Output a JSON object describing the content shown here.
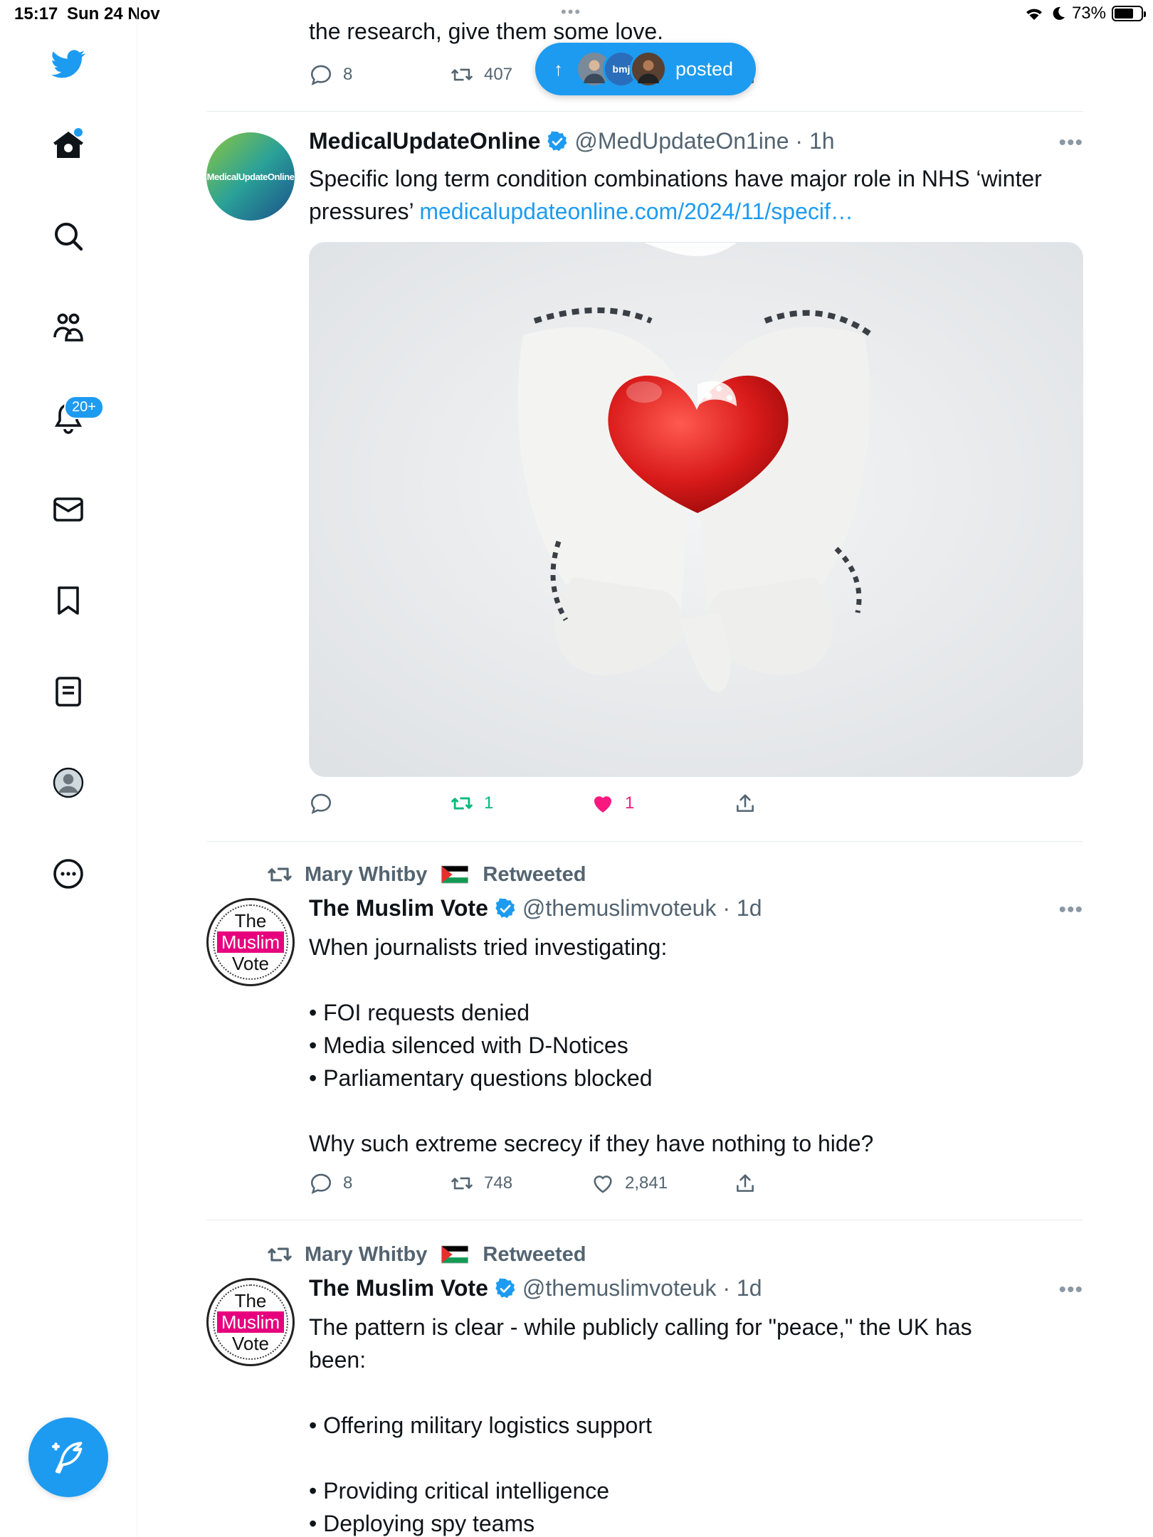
{
  "status_bar": {
    "time": "15:17",
    "date": "Sun 24 Nov",
    "battery": "73%",
    "battery_level": 0.73
  },
  "sidebar": {
    "notifications_badge": "20+"
  },
  "previous_tweet": {
    "text_tail": "the research, give them some love.",
    "replies": "8",
    "retweets": "407"
  },
  "new_posts_pill": {
    "label": "posted",
    "avatar_text": "bmj"
  },
  "tweets": [
    {
      "display_name": "MedicalUpdateOnline",
      "handle": "@MedUpdateOn1ine",
      "time": "1h",
      "avatar_text": "MedicalUpdateOnline",
      "text": "Specific long term condition combinations have major role in NHS ‘winter pressures’",
      "link": "medicalupdateonline.com/2024/11/specif…",
      "replies": "",
      "retweets": "1",
      "likes": "1"
    },
    {
      "retweeted_by": "Mary Whitby",
      "retweeted_label": "Retweeted",
      "display_name": "The Muslim Vote",
      "handle": "@themuslimvoteuk",
      "time": "1d",
      "avatar_lines": [
        "The",
        "Muslim",
        "Vote"
      ],
      "lines": [
        "When journalists tried investigating:",
        "",
        "• FOI requests denied",
        "• Media silenced with D-Notices",
        "• Parliamentary questions blocked",
        "",
        "Why such extreme secrecy if they have nothing to hide?"
      ],
      "replies": "8",
      "retweets": "748",
      "likes": "2,841"
    },
    {
      "retweeted_by": "Mary Whitby",
      "retweeted_label": "Retweeted",
      "display_name": "The Muslim Vote",
      "handle": "@themuslimvoteuk",
      "time": "1d",
      "avatar_lines": [
        "The",
        "Muslim",
        "Vote"
      ],
      "lines": [
        "The pattern is clear - while publicly calling for \"peace,\" the UK has",
        "been:",
        "",
        "• Offering military logistics support",
        "",
        "• Providing critical intelligence",
        "• Deploying spy teams"
      ]
    }
  ],
  "colors": {
    "accent": "#1d9bf0",
    "like": "#f91880",
    "retweet_active": "#00ba7c",
    "secondary_text": "#536471"
  }
}
